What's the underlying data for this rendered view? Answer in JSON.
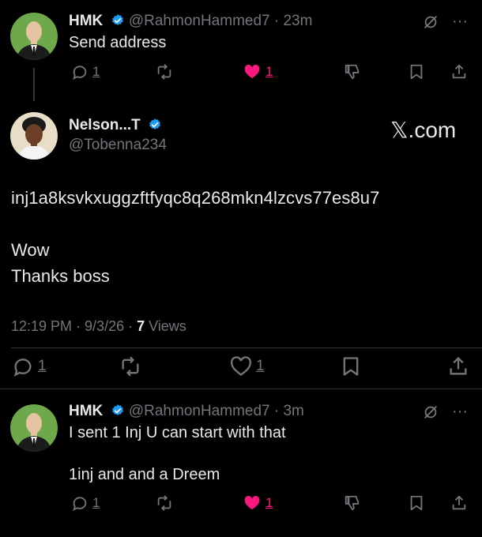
{
  "reply1": {
    "name": "HMK",
    "handle": "@RahmonHammed7",
    "sep": "·",
    "time": "23m",
    "text": "Send address",
    "replies": "1",
    "likes": "1"
  },
  "main": {
    "name": "Nelson...T",
    "handle": "@Tobenna234",
    "watermark": "𝕏.com",
    "address": "inj1a8ksvkxuggzftfyqc8q268mkn4lzcvs77es8u7",
    "line2": "Wow",
    "line3": "Thanks boss",
    "timestamp": "12:19 PM · 9/3/26 · ",
    "views_count": "7",
    "views_label": " Views",
    "replies": "1",
    "likes": "1"
  },
  "reply2": {
    "name": "HMK",
    "handle": "@RahmonHammed7",
    "sep": "·",
    "time": "3m",
    "text1": "I sent 1 Inj U can start with that",
    "text2": "1inj and and a Dreem",
    "replies": "1",
    "likes": "1"
  },
  "colors": {
    "like_active": "#f91880",
    "verified": "#1d9bf0",
    "muted": "#71767b"
  }
}
